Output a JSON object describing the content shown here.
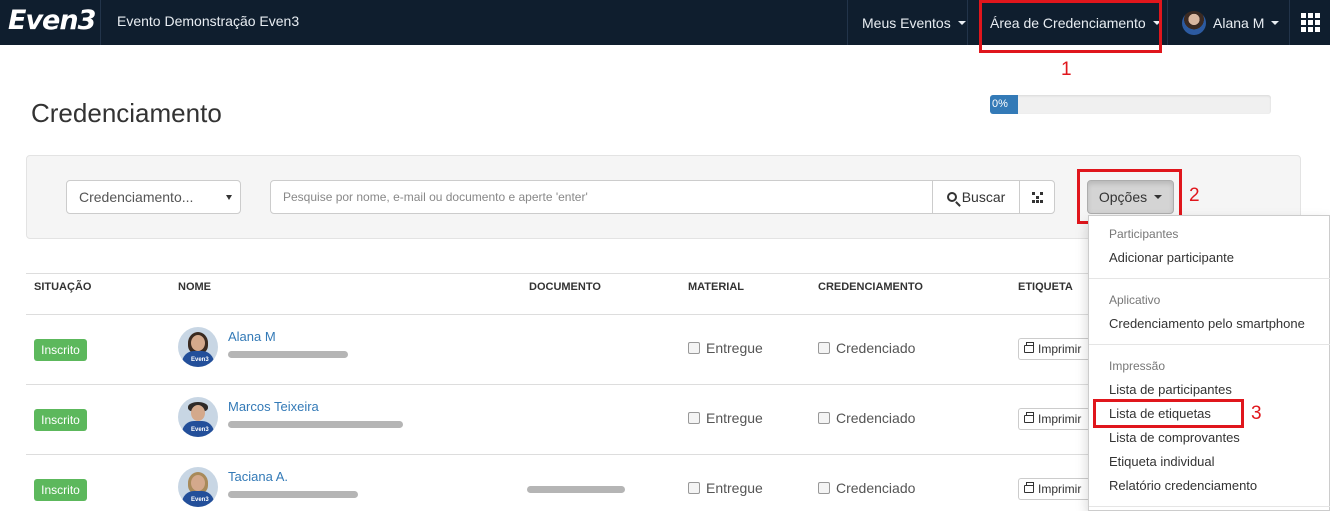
{
  "navbar": {
    "brand": "Even3",
    "event_title": "Evento Demonstração Even3",
    "meus_eventos": "Meus Eventos",
    "area_credenciamento": "Área de Credenciamento",
    "user_name": "Alana M",
    "apps_icon": "grid-icon"
  },
  "annotations": [
    "1",
    "2",
    "3"
  ],
  "page": {
    "title": "Credenciamento",
    "progress_label": "0%",
    "progress_value": 0
  },
  "toolbar": {
    "select_value": "Credenciamento...",
    "search_placeholder": "Pesquise por nome, e-mail ou documento e aperte 'enter'",
    "search_button": "Buscar",
    "options_button": "Opções"
  },
  "table": {
    "headers": [
      "SITUAÇÃO",
      "NOME",
      "DOCUMENTO",
      "MATERIAL",
      "CREDENCIAMENTO",
      "ETIQUETA"
    ],
    "rows": [
      {
        "status": "Inscrito",
        "name": "Alana M",
        "material": "Entregue",
        "credenciamento": "Credenciado",
        "etiqueta": "Imprimir"
      },
      {
        "status": "Inscrito",
        "name": "Marcos Teixeira",
        "material": "Entregue",
        "credenciamento": "Credenciado",
        "etiqueta": "Imprimir"
      },
      {
        "status": "Inscrito",
        "name": "Taciana A.",
        "material": "Entregue",
        "credenciamento": "Credenciado",
        "etiqueta": "Imprimir"
      }
    ]
  },
  "dropdown": {
    "sections": [
      {
        "header": "Participantes",
        "items": [
          "Adicionar participante"
        ]
      },
      {
        "header": "Aplicativo",
        "items": [
          "Credenciamento pelo smartphone"
        ]
      },
      {
        "header": "Impressão",
        "items": [
          "Lista de participantes",
          "Lista de etiquetas",
          "Lista de comprovantes",
          "Etiqueta individual",
          "Relatório credenciamento"
        ]
      }
    ]
  },
  "colors": {
    "navbar": "#0f1e2e",
    "annotation": "#e0161c",
    "badge": "#5cb85c",
    "link": "#337ab7"
  }
}
